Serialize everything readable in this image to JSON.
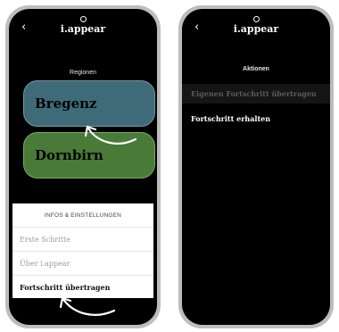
{
  "left_screen": {
    "back_icon": "‹",
    "logo_text": "i.appear",
    "section_title": "Regionen",
    "regions": [
      "Bregenz",
      "Dornbirn"
    ],
    "sheet": {
      "title": "INFOS & EINSTELLUNGEN",
      "items": [
        "Erste Schritte",
        "Über i.appear",
        "Fortschritt übertragen"
      ]
    }
  },
  "right_screen": {
    "back_icon": "‹",
    "logo_text": "i.appear",
    "section_title": "Aktionen",
    "items": [
      "Eigenen Fortschritt übertragen",
      "Fortschritt erhalten"
    ]
  },
  "colors": {
    "bregenz": "#3f6b78",
    "dornbirn": "#4a7a38",
    "phone_frame": "#bdbdbd"
  }
}
